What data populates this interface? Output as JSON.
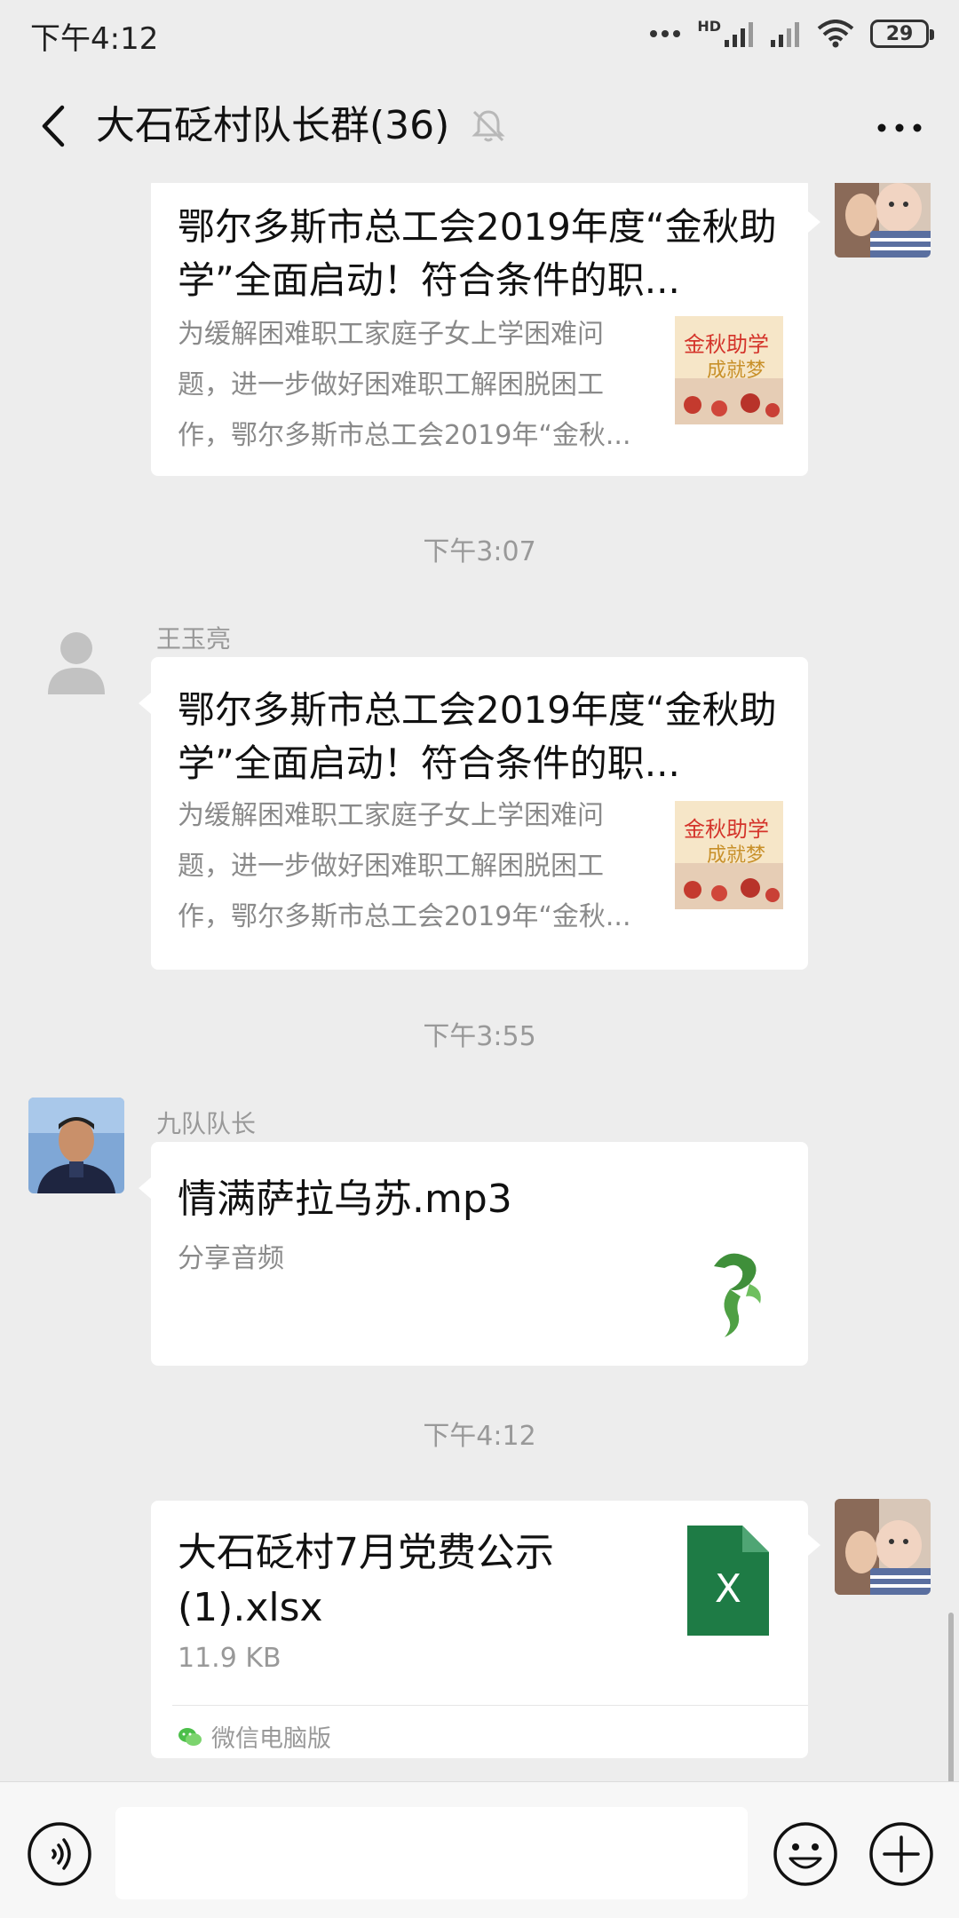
{
  "status_bar": {
    "time": "下午4:12",
    "network": "HD",
    "battery": "29"
  },
  "header": {
    "title": "大石砭村队长群(36)"
  },
  "messages": {
    "msg1": {
      "title": "鄂尔多斯市总工会2019年度“金秋助学”全面启动！符合条件的职...",
      "description": "为缓解困难职工家庭子女上学困难问题，进一步做好困难职工解困脱困工作，鄂尔多斯市总工会2019年“金秋...",
      "thumb_text": "金秋助学 成就梦想"
    },
    "ts1": "下午3:07",
    "msg2": {
      "sender": "王玉亮",
      "title": "鄂尔多斯市总工会2019年度“金秋助学”全面启动！符合条件的职...",
      "description": "为缓解困难职工家庭子女上学困难问题，进一步做好困难职工解困脱困工作，鄂尔多斯市总工会2019年“金秋...",
      "thumb_text": "金秋助学 成就梦想"
    },
    "ts2": "下午3:55",
    "msg3": {
      "sender": "九队队长",
      "title": "情满萨拉乌苏.mp3",
      "subtitle": "分享音频"
    },
    "ts3": "下午4:12",
    "msg4": {
      "file_name": "大石砭村7月党费公示(1).xlsx",
      "file_size": "11.9 KB",
      "source": "微信电脑版",
      "file_icon_letter": "X"
    }
  },
  "colors": {
    "background": "#ededed",
    "excel_green": "#1e7b45",
    "card": "#ffffff"
  },
  "icons": [
    "back-arrow-icon",
    "mute-bell-icon",
    "more-icon",
    "voice-icon",
    "emoji-icon",
    "plus-icon",
    "excel-file-icon",
    "wechat-icon",
    "default-avatar-icon"
  ]
}
